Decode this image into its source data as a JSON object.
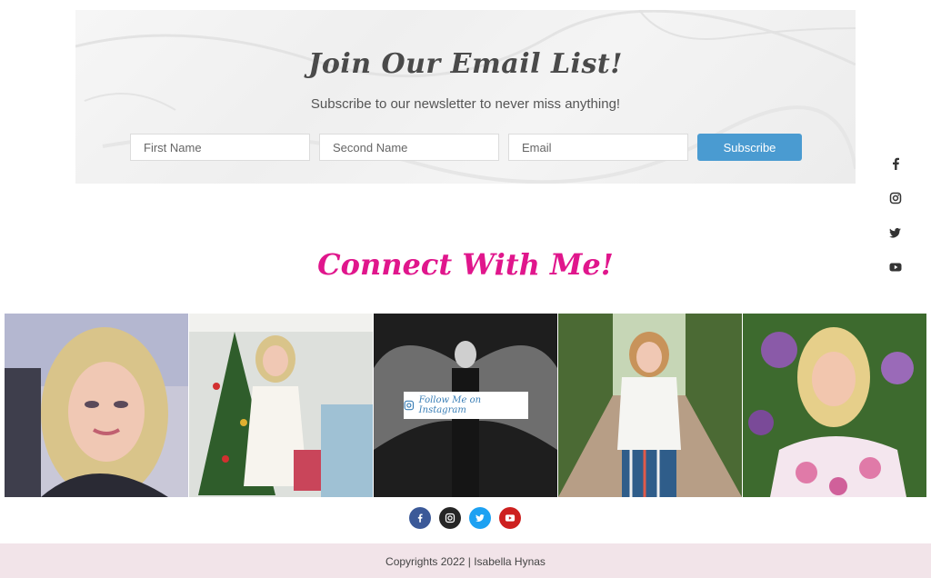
{
  "newsletter": {
    "title": "Join Our Email List!",
    "subtitle": "Subscribe to our newsletter to never miss anything!",
    "first_name_placeholder": "First Name",
    "second_name_placeholder": "Second Name",
    "email_placeholder": "Email",
    "subscribe_label": "Subscribe",
    "button_color": "#4a9bd1"
  },
  "side_social": [
    "facebook-icon",
    "instagram-icon",
    "twitter-icon",
    "youtube-icon"
  ],
  "connect": {
    "title": "Connect With Me!",
    "title_color": "#e0168c",
    "follow_label": "Follow Me on Instagram"
  },
  "round_social": [
    {
      "name": "facebook-icon",
      "color": "#3b5998"
    },
    {
      "name": "instagram-icon",
      "color": "#262626"
    },
    {
      "name": "twitter-icon",
      "color": "#1da1f2"
    },
    {
      "name": "youtube-icon",
      "color": "#cd201f"
    }
  ],
  "footer": {
    "copyright": "Copyrights 2022 | Isabella Hynas",
    "background": "#f2e4e9"
  }
}
